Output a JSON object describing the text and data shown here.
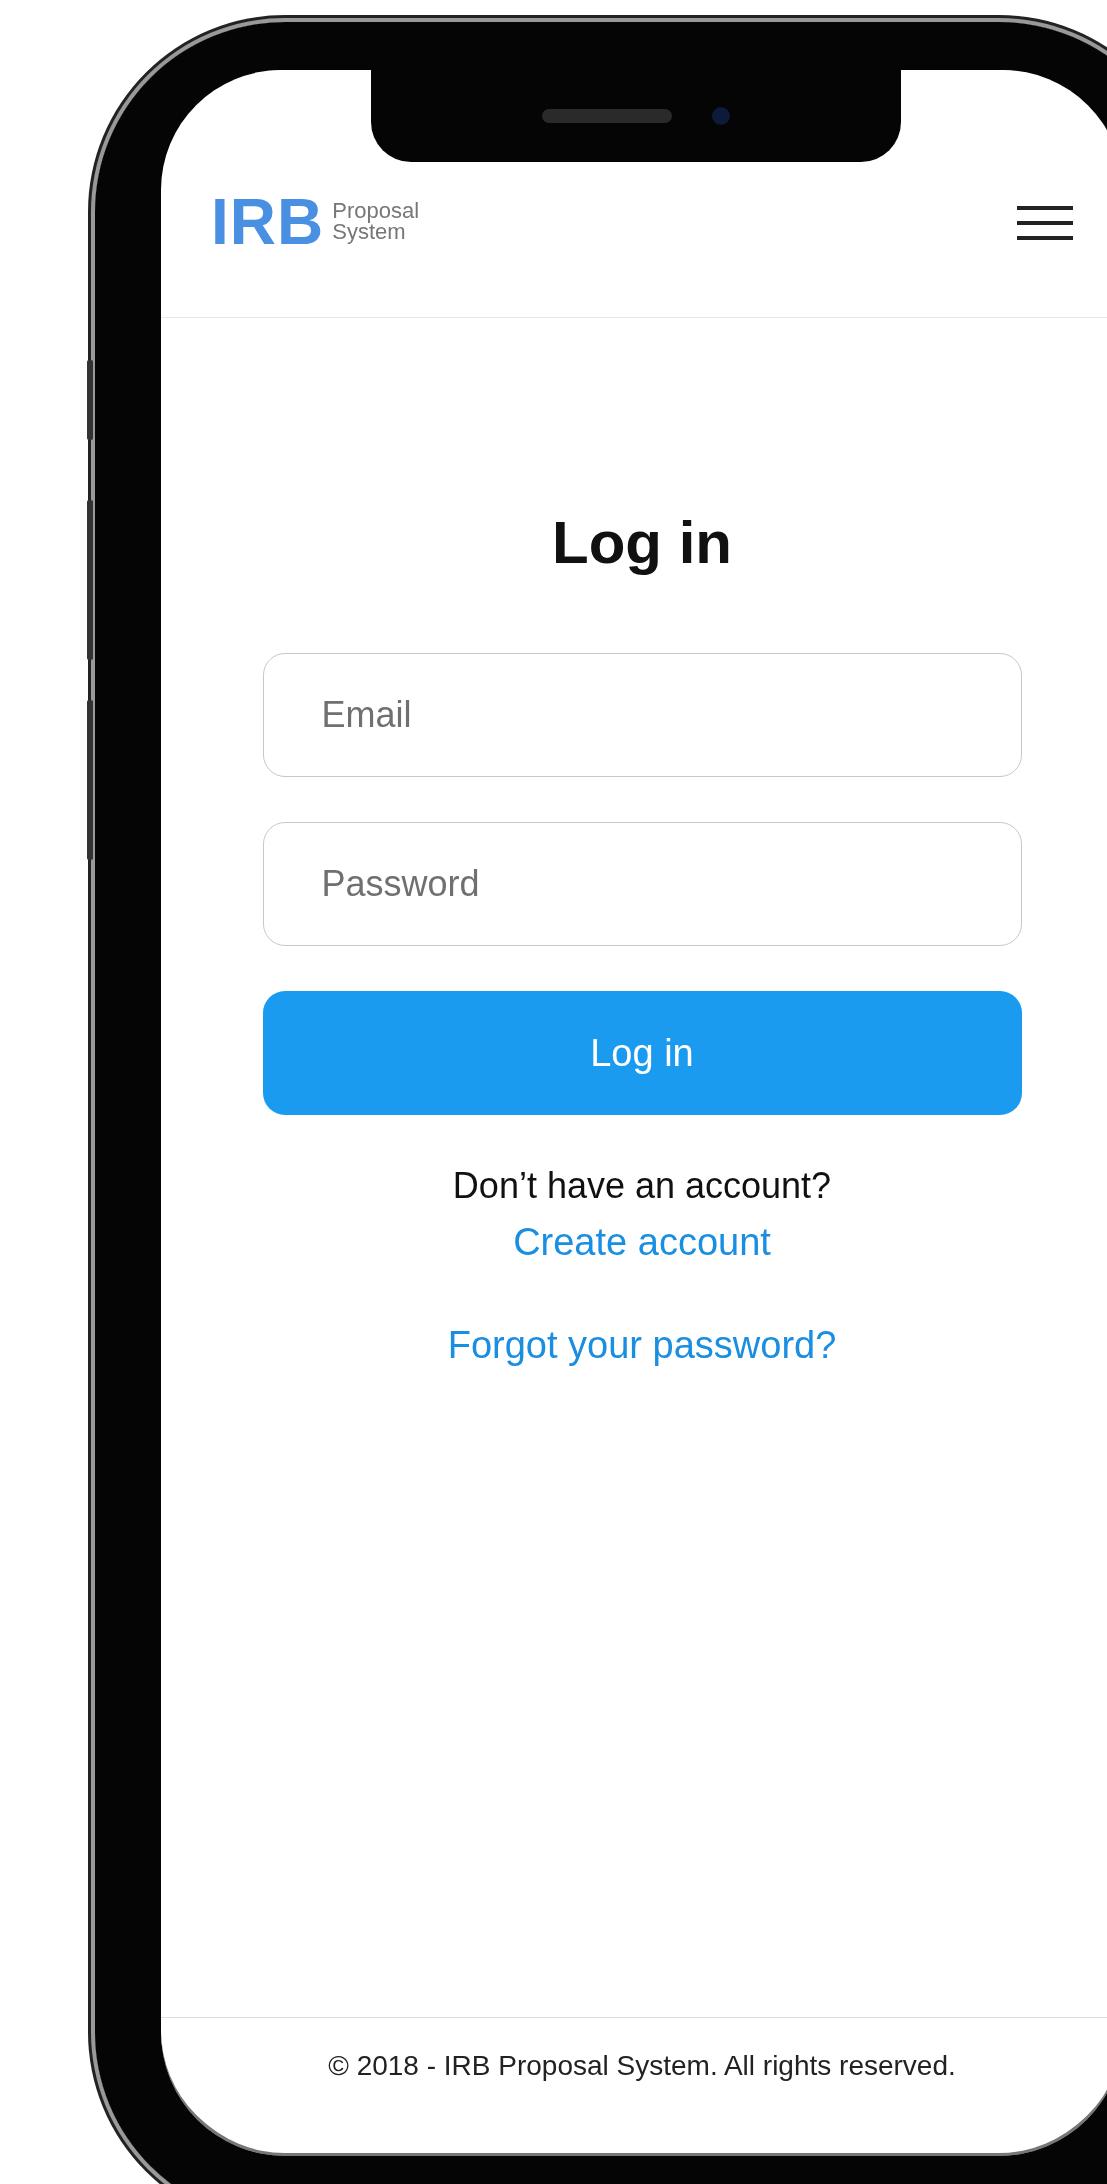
{
  "header": {
    "logo": {
      "mark": "IRB",
      "subtitle_lines": [
        "Proposal",
        "System"
      ]
    }
  },
  "login": {
    "title": "Log in",
    "fields": [
      {
        "placeholder": "Email"
      },
      {
        "placeholder": "Password"
      }
    ],
    "submit": "Log in",
    "signup_prompt": "Don’t have an account?",
    "signup_link": "Create account",
    "forgot_link": "Forgot your password?"
  },
  "footer": {
    "text": "© 2018 - IRB Proposal System. All rights reserved."
  }
}
